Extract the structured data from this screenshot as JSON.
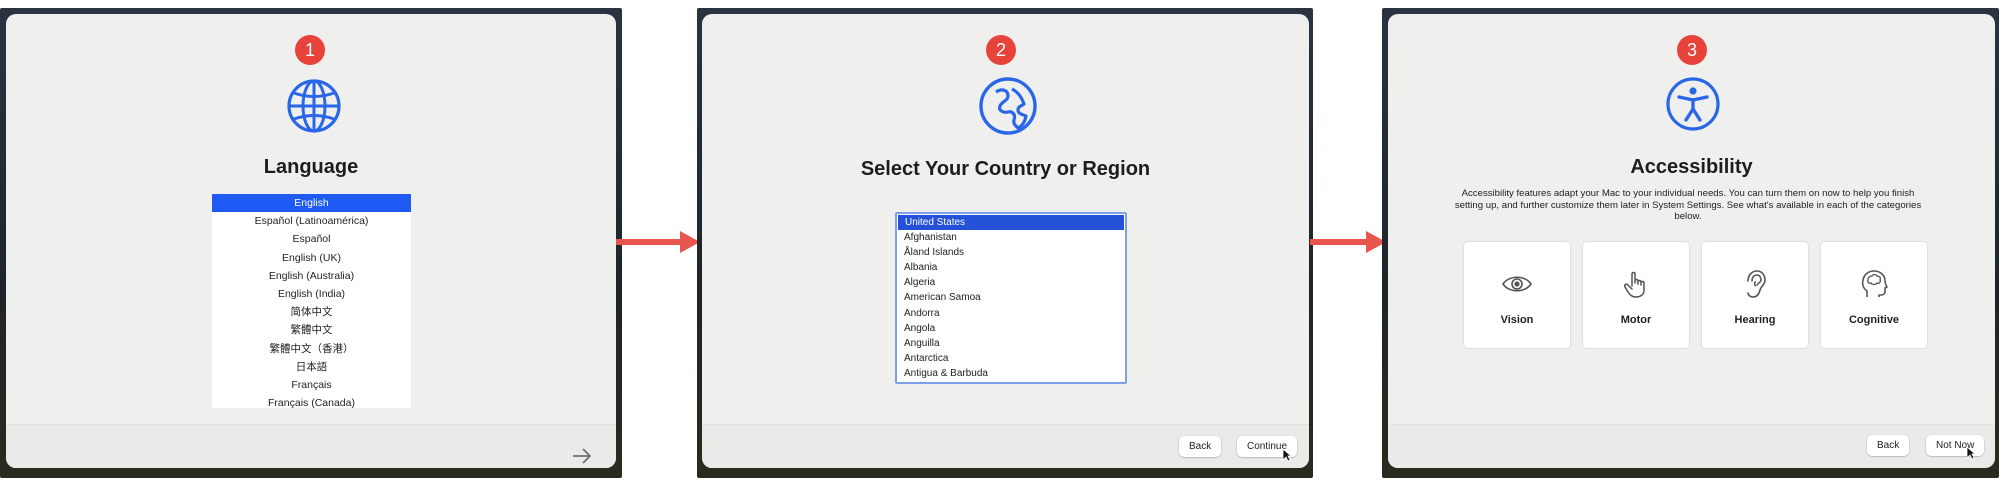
{
  "panel1": {
    "step": "1",
    "icon": "globe-icon",
    "title": "Language",
    "languages": [
      "English",
      "Español (Latinoamérica)",
      "Español",
      "English (UK)",
      "English (Australia)",
      "English (India)",
      "简体中文",
      "繁體中文",
      "繁體中文（香港）",
      "日本語",
      "Français",
      "Français (Canada)"
    ],
    "selected": "English",
    "next_icon": "arrow-right-icon"
  },
  "panel2": {
    "step": "2",
    "icon": "earth-icon",
    "title": "Select Your Country or Region",
    "countries": [
      "United States",
      "Afghanistan",
      "Åland Islands",
      "Albania",
      "Algeria",
      "American Samoa",
      "Andorra",
      "Angola",
      "Anguilla",
      "Antarctica",
      "Antigua & Barbuda"
    ],
    "selected": "United States",
    "back_label": "Back",
    "continue_label": "Continue"
  },
  "panel3": {
    "step": "3",
    "icon": "accessibility-icon",
    "title": "Accessibility",
    "description": "Accessibility features adapt your Mac to your individual needs. You can turn them on now to help you finish setting up, and further customize them later in System Settings. See what's available in each of the categories below.",
    "categories": [
      {
        "label": "Vision",
        "icon": "eye-icon"
      },
      {
        "label": "Motor",
        "icon": "hand-pointer-icon"
      },
      {
        "label": "Hearing",
        "icon": "ear-icon"
      },
      {
        "label": "Cognitive",
        "icon": "head-brain-icon"
      }
    ],
    "back_label": "Back",
    "not_now_label": "Not Now"
  },
  "colors": {
    "badge": "#e8433a",
    "connector_arrow": "#e8554e",
    "selection_blue": "#1f5af5",
    "icon_blue": "#2a66e8"
  }
}
